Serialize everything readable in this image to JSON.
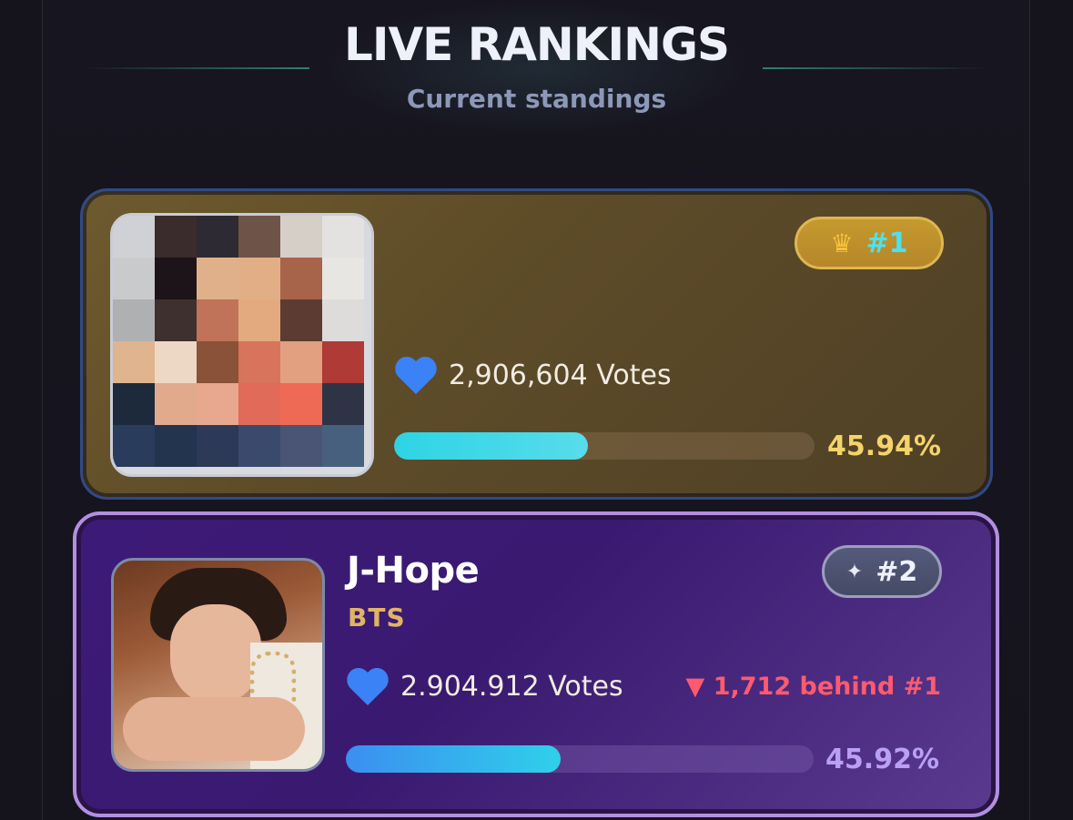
{
  "header": {
    "title": "LIVE RANKINGS",
    "subtitle": "Current standings"
  },
  "rankings": [
    {
      "rank_label": "#1",
      "rank_icon": "crown-icon",
      "name": "",
      "group": "",
      "votes_text": "2,906,604 Votes",
      "votes": 2906604,
      "percent_text": "45.94%",
      "percent": 45.94,
      "bar_fill_fraction": 0.46,
      "avatar_blurred": true
    },
    {
      "rank_label": "#2",
      "rank_icon": "sparkle-icon",
      "name": "J-Hope",
      "group": "BTS",
      "votes_text": "2.904.912 Votes",
      "votes": 2904912,
      "behind_text": "▼ 1,712 behind #1",
      "percent_text": "45.92%",
      "percent": 45.92,
      "bar_fill_fraction": 0.46,
      "avatar_blurred": false
    }
  ],
  "colors": {
    "background": "#15131c",
    "card1_border": "#2f4a86",
    "card2_border": "#b38fe0",
    "heart": "#3b82f6",
    "percent1": "#f4d46a",
    "percent2": "#b9a0f4",
    "behind": "#ff5a6e",
    "group": "#e0b463"
  }
}
